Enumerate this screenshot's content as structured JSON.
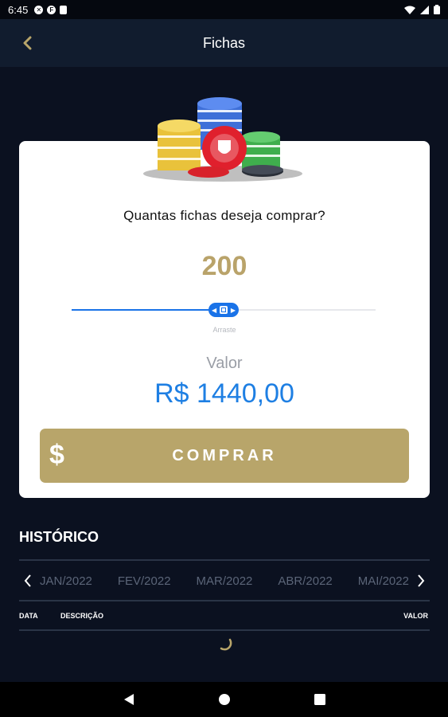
{
  "status_bar": {
    "time": "6:45"
  },
  "app_bar": {
    "title": "Fichas",
    "back_icon": "chevron-left-icon"
  },
  "purchase": {
    "question": "Quantas fichas deseja comprar?",
    "amount": "200",
    "slider_fraction": 0.5,
    "slider_hint": "Arraste",
    "price_label": "Valor",
    "price": "R$ 1440,00",
    "buy_icon": "$",
    "buy_label": "COMPRAR"
  },
  "history": {
    "title": "HISTÓRICO",
    "months": [
      "JAN/2022",
      "FEV/2022",
      "MAR/2022",
      "ABR/2022",
      "MAI/2022"
    ],
    "columns": {
      "date": "DATA",
      "description": "DESCRIÇÃO",
      "value": "VALOR"
    }
  },
  "colors": {
    "background": "#0b1120",
    "app_bar": "#111c2e",
    "gold": "#b8a56a",
    "blue": "#1e7fe3",
    "slider": "#1a73e8"
  }
}
